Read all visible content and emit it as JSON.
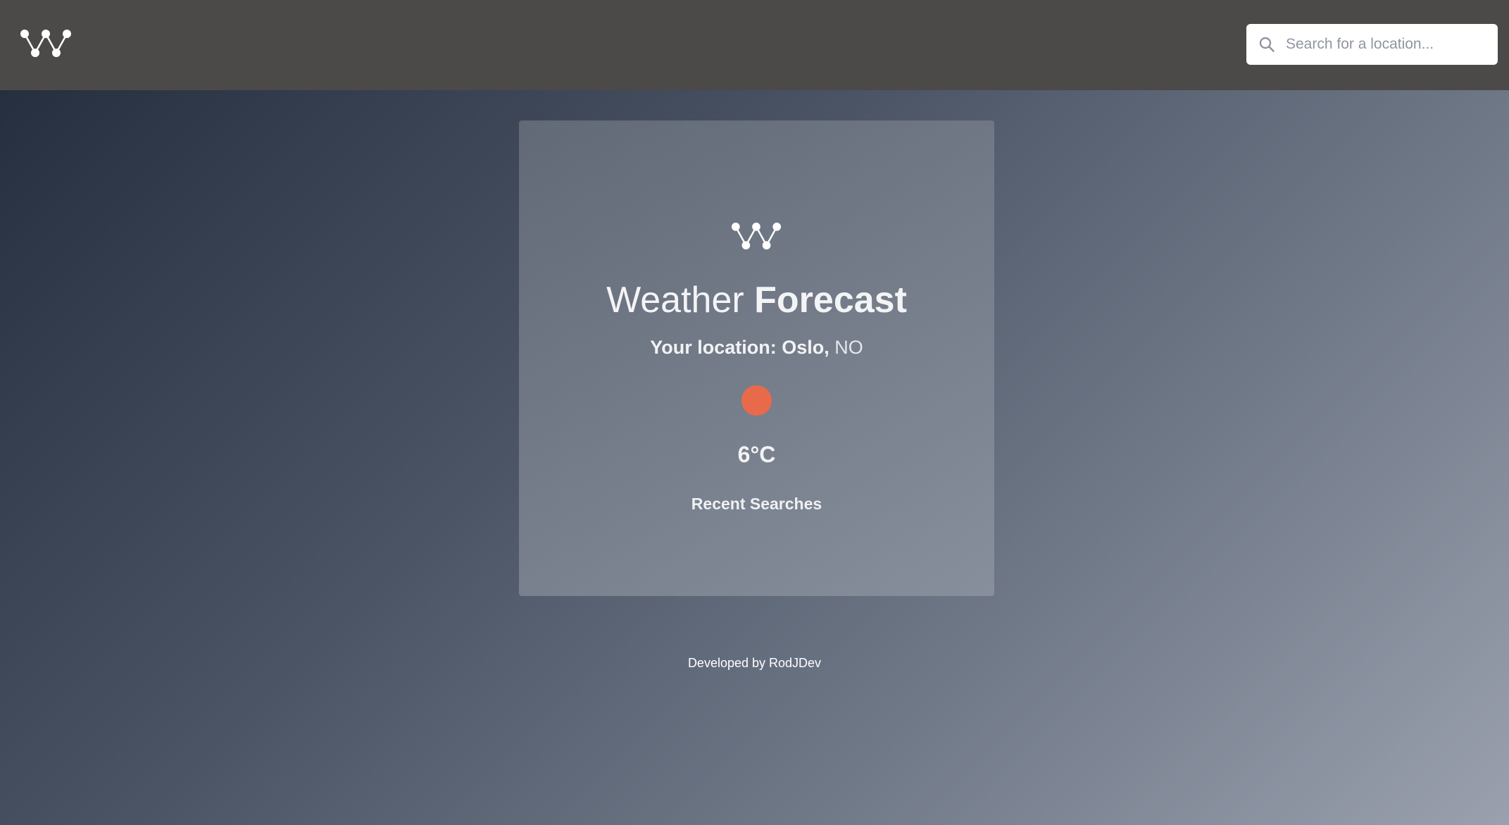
{
  "header": {
    "logo_icon": "w-constellation-logo-icon",
    "search": {
      "icon": "search-icon",
      "placeholder": "Search for a location...",
      "value": ""
    }
  },
  "card": {
    "logo_icon": "w-constellation-logo-icon",
    "title_light": "Weather",
    "title_bold": "Forecast",
    "location_label": "Your location:",
    "city": "Oslo,",
    "country": "NO",
    "weather_icon": "sun-dot-icon",
    "weather_icon_color": "#e96a4b",
    "temperature": "6°C",
    "recent_searches_label": "Recent Searches"
  },
  "footer": {
    "credit": "Developed by RodJDev"
  },
  "colors": {
    "topbar": "#4b4a48",
    "accent": "#e96a4b"
  }
}
